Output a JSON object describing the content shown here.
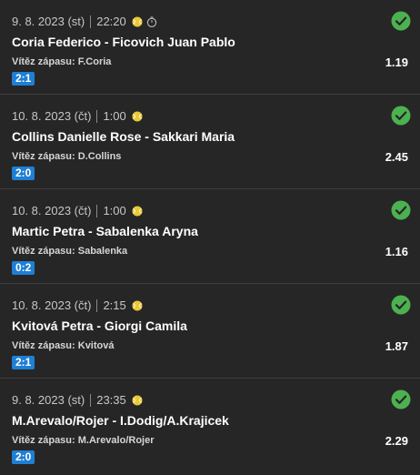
{
  "bets": [
    {
      "date": "9. 8. 2023 (st)",
      "time": "22:20",
      "timer": true,
      "match": "Coria Federico - Ficovich Juan Pablo",
      "winner_label": "Vítěz zápasu:",
      "winner": "F.Coria",
      "odds": "1.19",
      "score": "2:1",
      "status": "won"
    },
    {
      "date": "10. 8. 2023 (čt)",
      "time": "1:00",
      "timer": false,
      "match": "Collins Danielle Rose - Sakkari Maria",
      "winner_label": "Vítěz zápasu:",
      "winner": "D.Collins",
      "odds": "2.45",
      "score": "2:0",
      "status": "won"
    },
    {
      "date": "10. 8. 2023 (čt)",
      "time": "1:00",
      "timer": false,
      "match": "Martic Petra - Sabalenka Aryna",
      "winner_label": "Vítěz zápasu:",
      "winner": "Sabalenka",
      "odds": "1.16",
      "score": "0:2",
      "status": "won"
    },
    {
      "date": "10. 8. 2023 (čt)",
      "time": "2:15",
      "timer": false,
      "match": "Kvitová Petra - Giorgi Camila",
      "winner_label": "Vítěz zápasu:",
      "winner": "Kvitová",
      "odds": "1.87",
      "score": "2:1",
      "status": "won"
    },
    {
      "date": "9. 8. 2023 (st)",
      "time": "23:35",
      "timer": false,
      "match": "M.Arevalo/Rojer - I.Dodig/A.Krajicek",
      "winner_label": "Vítěz zápasu:",
      "winner": "M.Arevalo/Rojer",
      "odds": "2.29",
      "score": "2:0",
      "status": "won"
    }
  ],
  "colors": {
    "background": "#262626",
    "score_badge": "#1e7fd4",
    "check": "#4cb150",
    "ball": "#e8c93a"
  },
  "icons": {
    "sport": "tennis-ball-icon",
    "timer": "stopwatch-icon",
    "status": "check-circle-icon"
  }
}
